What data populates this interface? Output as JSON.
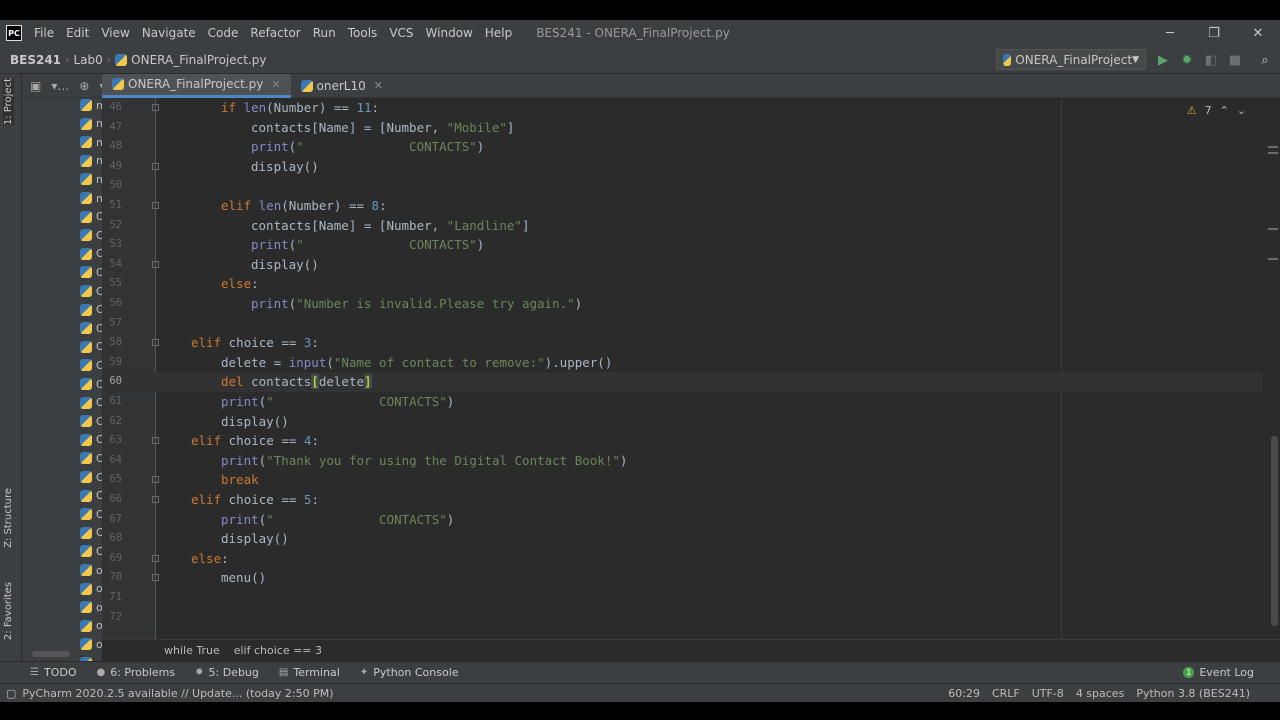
{
  "app": {
    "logo": "PC",
    "menu": [
      "File",
      "Edit",
      "View",
      "Navigate",
      "Code",
      "Refactor",
      "Run",
      "Tools",
      "VCS",
      "Window",
      "Help"
    ],
    "window_title": "BES241 - ONERA_FinalProject.py",
    "window_controls": {
      "minimize": "─",
      "restore": "❐",
      "close": "✕"
    }
  },
  "navbar": {
    "crumbs": [
      "BES241",
      "Lab0",
      "ONERA_FinalProject.py"
    ],
    "run_config": "ONERA_FinalProject",
    "icons": [
      "run-icon",
      "debug-icon",
      "coverage-icon",
      "stop-icon",
      "search-icon"
    ]
  },
  "tabs": [
    {
      "label": "ONERA_FinalProject.py",
      "active": true
    },
    {
      "label": "onerL10",
      "active": false
    }
  ],
  "side_labels": {
    "project": "1: Project",
    "structure": "Z: Structure",
    "favorites": "2: Favorites"
  },
  "project_files": [
    "m",
    "m",
    "m",
    "m",
    "m",
    "m",
    "O",
    "O",
    "O",
    "O",
    "O",
    "O",
    "O",
    "O",
    "O",
    "O",
    "O",
    "O",
    "O",
    "O",
    "O",
    "O",
    "O",
    "O",
    "O",
    "o",
    "o",
    "o",
    "o",
    "o",
    "o",
    "o",
    "o",
    "o"
  ],
  "editor": {
    "inspection_count": "7",
    "current_line": "60",
    "lines": [
      {
        "n": "46",
        "indent": 2,
        "tokens": [
          [
            "kw",
            "if "
          ],
          [
            "bi",
            "len"
          ],
          [
            "t",
            "(Number) == "
          ],
          [
            "num",
            "11"
          ],
          [
            "t",
            ":"
          ]
        ]
      },
      {
        "n": "47",
        "indent": 3,
        "tokens": [
          [
            "t",
            "contacts[Name] = [Number, "
          ],
          [
            "str",
            "\"Mobile\""
          ],
          [
            "t",
            "]"
          ]
        ]
      },
      {
        "n": "48",
        "indent": 3,
        "tokens": [
          [
            "bi",
            "print"
          ],
          [
            "t",
            "("
          ],
          [
            "str",
            "\"              CONTACTS\""
          ],
          [
            "t",
            ")"
          ]
        ]
      },
      {
        "n": "49",
        "indent": 3,
        "tokens": [
          [
            "t",
            "display()"
          ]
        ]
      },
      {
        "n": "50",
        "indent": 0,
        "tokens": []
      },
      {
        "n": "51",
        "indent": 2,
        "tokens": [
          [
            "kw",
            "elif "
          ],
          [
            "bi",
            "len"
          ],
          [
            "t",
            "(Number) == "
          ],
          [
            "num",
            "8"
          ],
          [
            "t",
            ":"
          ]
        ]
      },
      {
        "n": "52",
        "indent": 3,
        "tokens": [
          [
            "t",
            "contacts[Name] = [Number, "
          ],
          [
            "str",
            "\"Landline\""
          ],
          [
            "t",
            "]"
          ]
        ]
      },
      {
        "n": "53",
        "indent": 3,
        "tokens": [
          [
            "bi",
            "print"
          ],
          [
            "t",
            "("
          ],
          [
            "str",
            "\"              CONTACTS\""
          ],
          [
            "t",
            ")"
          ]
        ]
      },
      {
        "n": "54",
        "indent": 3,
        "tokens": [
          [
            "t",
            "display()"
          ]
        ]
      },
      {
        "n": "55",
        "indent": 2,
        "tokens": [
          [
            "kw",
            "else"
          ],
          [
            "t",
            ":"
          ]
        ]
      },
      {
        "n": "56",
        "indent": 3,
        "tokens": [
          [
            "bi",
            "print"
          ],
          [
            "t",
            "("
          ],
          [
            "str",
            "\"Number is invalid.Please try again.\""
          ],
          [
            "t",
            ")"
          ]
        ]
      },
      {
        "n": "57",
        "indent": 0,
        "tokens": []
      },
      {
        "n": "58",
        "indent": 1,
        "tokens": [
          [
            "kw",
            "elif "
          ],
          [
            "t",
            "choice == "
          ],
          [
            "num",
            "3"
          ],
          [
            "t",
            ":"
          ]
        ]
      },
      {
        "n": "59",
        "indent": 2,
        "tokens": [
          [
            "t",
            "delete = "
          ],
          [
            "bi",
            "input"
          ],
          [
            "t",
            "("
          ],
          [
            "str",
            "\"Name of contact to remove:\""
          ],
          [
            "t",
            ").upper()"
          ]
        ]
      },
      {
        "n": "60",
        "indent": 2,
        "tokens": [
          [
            "kw",
            "del "
          ],
          [
            "t",
            "contacts"
          ],
          [
            "hl",
            "["
          ],
          [
            "t",
            "delete"
          ],
          [
            "hl",
            "]"
          ]
        ]
      },
      {
        "n": "61",
        "indent": 2,
        "tokens": [
          [
            "bi",
            "print"
          ],
          [
            "t",
            "("
          ],
          [
            "str",
            "\"              CONTACTS\""
          ],
          [
            "t",
            ")"
          ]
        ]
      },
      {
        "n": "62",
        "indent": 2,
        "tokens": [
          [
            "t",
            "display()"
          ]
        ]
      },
      {
        "n": "63",
        "indent": 1,
        "tokens": [
          [
            "kw",
            "elif "
          ],
          [
            "t",
            "choice == "
          ],
          [
            "num",
            "4"
          ],
          [
            "t",
            ":"
          ]
        ]
      },
      {
        "n": "64",
        "indent": 2,
        "tokens": [
          [
            "bi",
            "print"
          ],
          [
            "t",
            "("
          ],
          [
            "str",
            "\"Thank you for using the Digital Contact Book!\""
          ],
          [
            "t",
            ")"
          ]
        ]
      },
      {
        "n": "65",
        "indent": 2,
        "tokens": [
          [
            "kw",
            "break"
          ]
        ]
      },
      {
        "n": "66",
        "indent": 1,
        "tokens": [
          [
            "kw",
            "elif "
          ],
          [
            "t",
            "choice == "
          ],
          [
            "num",
            "5"
          ],
          [
            "t",
            ":"
          ]
        ]
      },
      {
        "n": "67",
        "indent": 2,
        "tokens": [
          [
            "bi",
            "print"
          ],
          [
            "t",
            "("
          ],
          [
            "str",
            "\"              CONTACTS\""
          ],
          [
            "t",
            ")"
          ]
        ]
      },
      {
        "n": "68",
        "indent": 2,
        "tokens": [
          [
            "t",
            "display()"
          ]
        ]
      },
      {
        "n": "69",
        "indent": 1,
        "tokens": [
          [
            "kw",
            "else"
          ],
          [
            "t",
            ":"
          ]
        ]
      },
      {
        "n": "70",
        "indent": 2,
        "tokens": [
          [
            "t",
            "menu()"
          ]
        ]
      },
      {
        "n": "71",
        "indent": 0,
        "tokens": []
      },
      {
        "n": "72",
        "indent": 0,
        "tokens": []
      }
    ],
    "breadcrumb": [
      "while True",
      "elif choice == 3"
    ]
  },
  "bottom_tools": [
    {
      "icon": "list-icon",
      "label": "TODO"
    },
    {
      "icon": "problems-icon",
      "label": "6: Problems"
    },
    {
      "icon": "debug-icon",
      "label": "5: Debug"
    },
    {
      "icon": "terminal-icon",
      "label": "Terminal"
    },
    {
      "icon": "python-console-icon",
      "label": "Python Console"
    }
  ],
  "event_log": "Event Log",
  "status": {
    "message": "PyCharm 2020.2.5 available // Update... (today 2:50 PM)",
    "position": "60:29",
    "line_sep": "CRLF",
    "encoding": "UTF-8",
    "indent": "4 spaces",
    "interpreter": "Python 3.8 (BES241)"
  },
  "colors": {
    "keyword": "#cc7832",
    "string": "#6a8759",
    "number": "#6897bb",
    "builtin": "#8888c6",
    "text": "#a9b7c6",
    "accent": "#4a88c7"
  }
}
